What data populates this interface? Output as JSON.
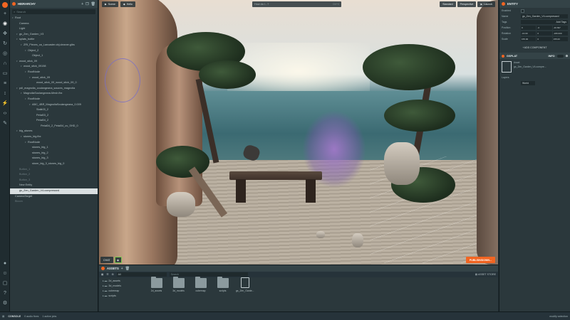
{
  "toolbar": {
    "tools": [
      "plus-icon",
      "eye-icon",
      "move-icon",
      "rotate-icon",
      "scale-icon",
      "globe-icon",
      "magnet-icon",
      "camera-icon",
      "layers-icon",
      "pan-icon",
      "bolt-icon",
      "code-icon",
      "paint-icon",
      "gear-icon"
    ],
    "bottom": [
      "github-icon",
      "discord-icon",
      "chat-icon",
      "help-icon",
      "settings-icon"
    ]
  },
  "hierarchy": {
    "title": "HIERARCHY",
    "search_placeholder": "Search",
    "items": [
      {
        "label": "Root",
        "indent": 0,
        "arrow": "▾"
      },
      {
        "label": "Camera",
        "indent": 1,
        "arrow": ""
      },
      {
        "label": "Light",
        "indent": 1,
        "arrow": ""
      },
      {
        "label": "gs_Zen_Garden_V3",
        "indent": 1,
        "arrow": "▾"
      },
      {
        "label": "splats_bottle",
        "indent": 1,
        "arrow": "▾"
      },
      {
        "label": "ZRI_Pieces_ca_Lancaster.obj.cleaner.glbs",
        "indent": 2,
        "arrow": "▾"
      },
      {
        "label": "Object_2",
        "indent": 3,
        "arrow": "▾"
      },
      {
        "label": "Object_1",
        "indent": 4,
        "arrow": ""
      },
      {
        "label": "wood_stick_09",
        "indent": 1,
        "arrow": "▾"
      },
      {
        "label": "wood_stick_09198",
        "indent": 2,
        "arrow": "▾"
      },
      {
        "label": "RootNode",
        "indent": 3,
        "arrow": "▾"
      },
      {
        "label": "wood_stick_09",
        "indent": 4,
        "arrow": "▾"
      },
      {
        "label": "wood_stick_09_wood_stick_09_0",
        "indent": 5,
        "arrow": ""
      },
      {
        "label": "pdl_magnolia_coulangeana_sauces_magnolia",
        "indent": 1,
        "arrow": "▾"
      },
      {
        "label": "MagnoliaSoulangeana-Mesh.fbx",
        "indent": 2,
        "arrow": "▾"
      },
      {
        "label": "RootNode",
        "indent": 3,
        "arrow": "▾"
      },
      {
        "label": "ABC_4BR_MagnoliaSoulangeana_0.009",
        "indent": 4,
        "arrow": "▾"
      },
      {
        "label": "Stalk03_2",
        "indent": 5,
        "arrow": ""
      },
      {
        "label": "Petal03_2",
        "indent": 5,
        "arrow": ""
      },
      {
        "label": "Petal04_2",
        "indent": 5,
        "arrow": ""
      },
      {
        "label": "Petal04_2_Petal04_uv_SHD_0",
        "indent": 6,
        "arrow": ""
      },
      {
        "label": "big_stones",
        "indent": 1,
        "arrow": "▾"
      },
      {
        "label": "stones_big.fbx",
        "indent": 2,
        "arrow": "▾"
      },
      {
        "label": "RootNode",
        "indent": 3,
        "arrow": "▾"
      },
      {
        "label": "stones_big_1",
        "indent": 4,
        "arrow": ""
      },
      {
        "label": "stones_big_2",
        "indent": 4,
        "arrow": ""
      },
      {
        "label": "stones_big_3",
        "indent": 4,
        "arrow": ""
      },
      {
        "label": "stone_big_3_stones_big_0",
        "indent": 4,
        "arrow": ""
      },
      {
        "label": "Button_1",
        "indent": 1,
        "arrow": "",
        "dim": true
      },
      {
        "label": "Button_2",
        "indent": 1,
        "arrow": "",
        "dim": true
      },
      {
        "label": "Button_3",
        "indent": 1,
        "arrow": "",
        "dim": true
      },
      {
        "label": "New Entity",
        "indent": 1,
        "arrow": ""
      },
      {
        "label": "gs_Zen_Garden_V4.compressed",
        "indent": 1,
        "arrow": "",
        "selected": true
      },
      {
        "label": "CameraTarget",
        "indent": 0,
        "arrow": ""
      },
      {
        "label": "Bloom",
        "indent": 0,
        "arrow": "",
        "dim": true
      }
    ]
  },
  "viewport": {
    "top_buttons": [
      "Scene",
      "Hello"
    ],
    "search_placeholder": "How do I...?",
    "search_shortcut": "Ctrl+K",
    "right_buttons": [
      "Standard",
      "Perspective",
      "Launch"
    ],
    "bottom_left": "CHAT",
    "publish": "PUBLISH/DOWN..."
  },
  "assets": {
    "title": "ASSETS",
    "filter": "All",
    "search_placeholder": "Search",
    "store": "ASSET STORE",
    "folders": [
      "2d_assets",
      "3d_models",
      "cubemap",
      "scripts"
    ],
    "thumbs": [
      {
        "label": "2d_assets",
        "kind": "folder"
      },
      {
        "label": "3d_models",
        "kind": "folder"
      },
      {
        "label": "cubemap",
        "kind": "folder"
      },
      {
        "label": "scripts",
        "kind": "folder"
      },
      {
        "label": "gs_Zen_Garde...",
        "kind": "file"
      }
    ]
  },
  "entity": {
    "title": "ENTITY",
    "enabled_label": "Enabled",
    "name_label": "Name",
    "name_value": "gs_Zen_Garden_V4.compressed",
    "tags_label": "Tags",
    "tags_value": "Add Tags",
    "position_label": "Position",
    "position": [
      "0",
      "-0",
      "-40.697"
    ],
    "rotation_label": "Rotation",
    "rotation": [
      "-16.99",
      "0",
      "-180.000"
    ],
    "scale_label": "Scale",
    "scale": [
      "155.00",
      "0",
      "155.00"
    ],
    "add_component": "ADD COMPONENT",
    "gsplat_title": "GSPLAT",
    "gsplat_info": "INFO",
    "asset_label": "Asset",
    "asset_value": "gs_Zen_Garden_V4.compre...",
    "layers_label": "Layers",
    "layers_value": "World"
  },
  "status": {
    "console": "CONSOLE",
    "messages": "0 audio fixes",
    "task": "1 active jobs",
    "right": "modify selection"
  }
}
